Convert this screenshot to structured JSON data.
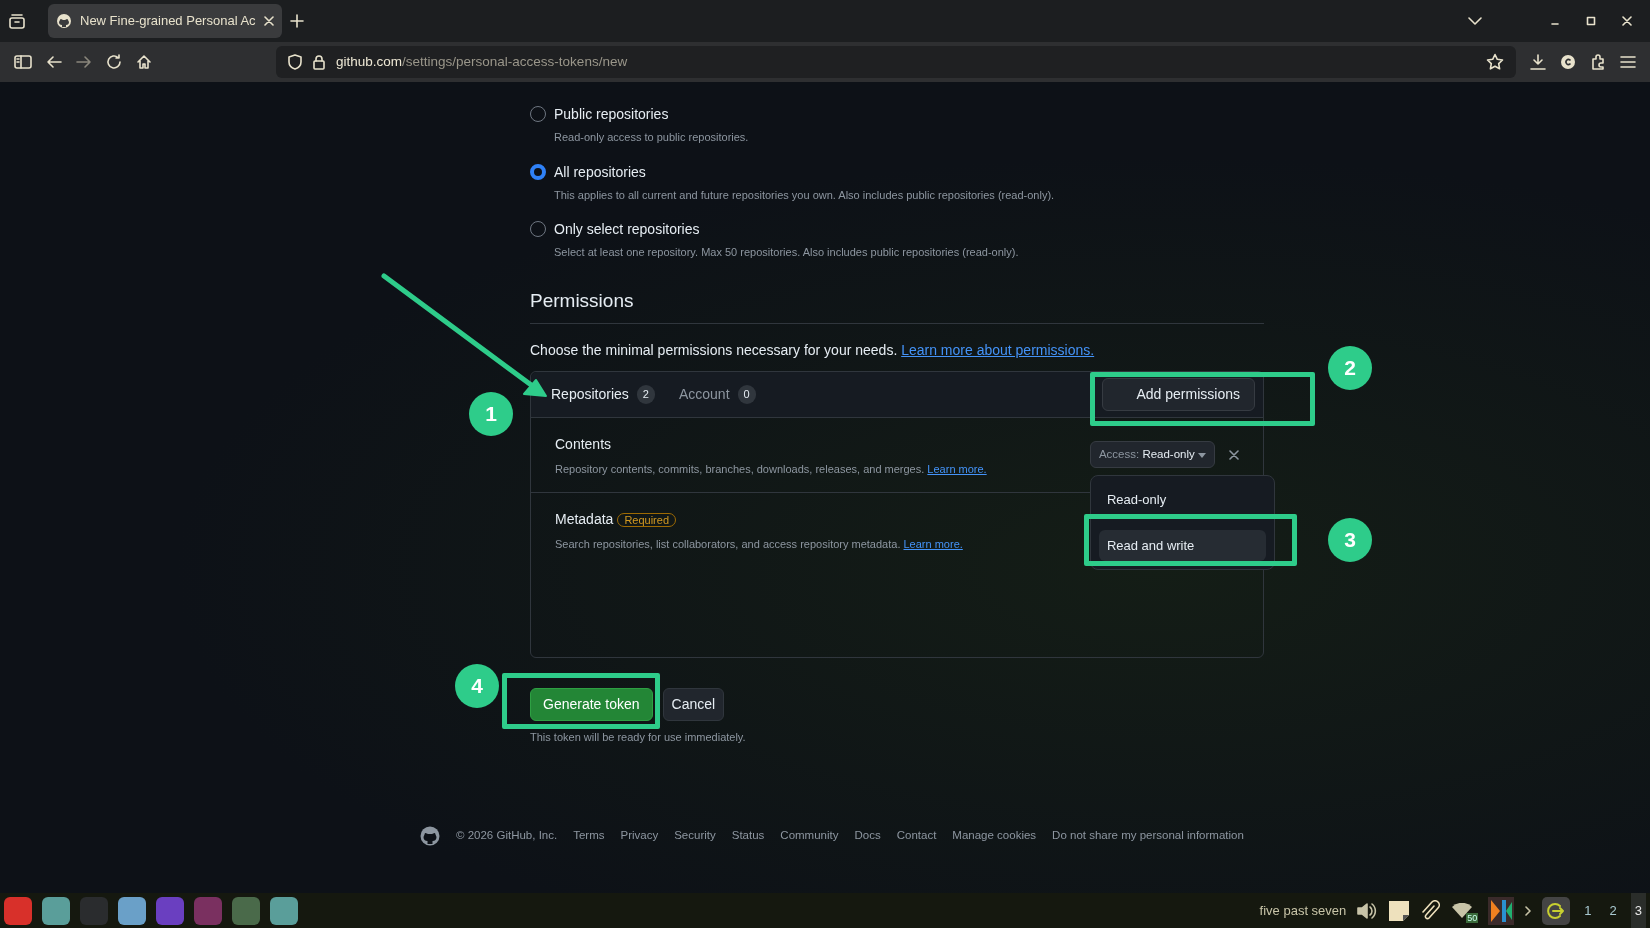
{
  "browser": {
    "tab_title": "New Fine-grained Personal Ac",
    "url_host": "github.com",
    "url_path": "/settings/personal-access-tokens/new"
  },
  "repository_access": [
    {
      "label": "Public repositories",
      "description": "Read-only access to public repositories.",
      "selected": false
    },
    {
      "label": "All repositories",
      "description": "This applies to all current and future repositories you own. Also includes public repositories (read-only).",
      "selected": true
    },
    {
      "label": "Only select repositories",
      "description": "Select at least one repository. Max 50 repositories. Also includes public repositories (read-only).",
      "selected": false
    }
  ],
  "permissions": {
    "heading": "Permissions",
    "intro": "Choose the minimal permissions necessary for your needs.",
    "intro_link": "Learn more about permissions.",
    "tabs": [
      {
        "label": "Repositories",
        "count": "2",
        "selected": true
      },
      {
        "label": "Account",
        "count": "0",
        "selected": false
      }
    ],
    "add_button": "Add permissions",
    "items": [
      {
        "name": "Contents",
        "description": "Repository contents, commits, branches, downloads, releases, and merges.",
        "link": "Learn more.",
        "access_label": "Access:",
        "access_value": "Read-only",
        "menu": [
          {
            "label": "Read-only",
            "selected": false
          },
          {
            "label": "Read and write",
            "selected": true
          }
        ]
      },
      {
        "name": "Metadata",
        "badge": "Required",
        "description": "Search repositories, list collaborators, and access repository metadata.",
        "link": "Learn more."
      }
    ]
  },
  "actions": {
    "generate": "Generate token",
    "cancel": "Cancel",
    "note": "This token will be ready for use immediately."
  },
  "footer": {
    "copyright": "© 2026 GitHub, Inc.",
    "links": [
      "Terms",
      "Privacy",
      "Security",
      "Status",
      "Community",
      "Docs",
      "Contact",
      "Manage cookies",
      "Do not share my personal information"
    ]
  },
  "taskbar": {
    "clock": "five past seven",
    "network_label": "50",
    "workspaces": [
      {
        "label": "1",
        "selected": false
      },
      {
        "label": "2",
        "selected": false
      },
      {
        "label": "3",
        "selected": true
      }
    ]
  },
  "annotations": [
    {
      "number": "1"
    },
    {
      "number": "2"
    },
    {
      "number": "3"
    },
    {
      "number": "4"
    }
  ]
}
